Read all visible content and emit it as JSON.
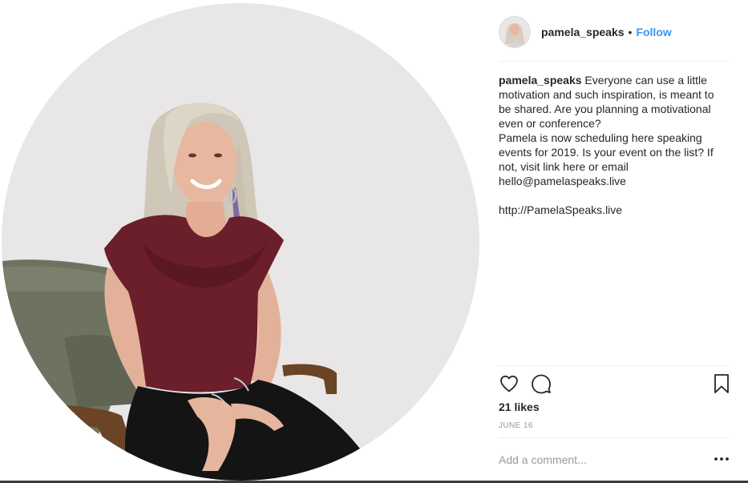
{
  "post": {
    "username": "pamela_speaks",
    "separator": "•",
    "follow_label": "Follow",
    "caption": {
      "username": "pamela_speaks",
      "paragraph1": " Everyone can use a little motivation and such inspiration, is meant to be shared. Are you planning a motivational even or conference?",
      "paragraph2": "Pamela is now scheduling here speaking events for 2019. Is your event on the list? If not, visit link here or email hello@pamelaspeaks.live",
      "link": "http://PamelaSpeaks.live"
    },
    "likes": "21 likes",
    "date": "JUNE 16",
    "comment_placeholder": "Add a comment...",
    "icons": {
      "like": "heart-icon",
      "comment": "comment-icon",
      "save": "bookmark-icon",
      "more": "more-options-icon"
    }
  },
  "colors": {
    "follow": "#3897f0",
    "text": "#262626",
    "muted": "#999999",
    "divider": "#efefef",
    "shirt": "#6b1f2a",
    "chair": "#6f7462"
  }
}
